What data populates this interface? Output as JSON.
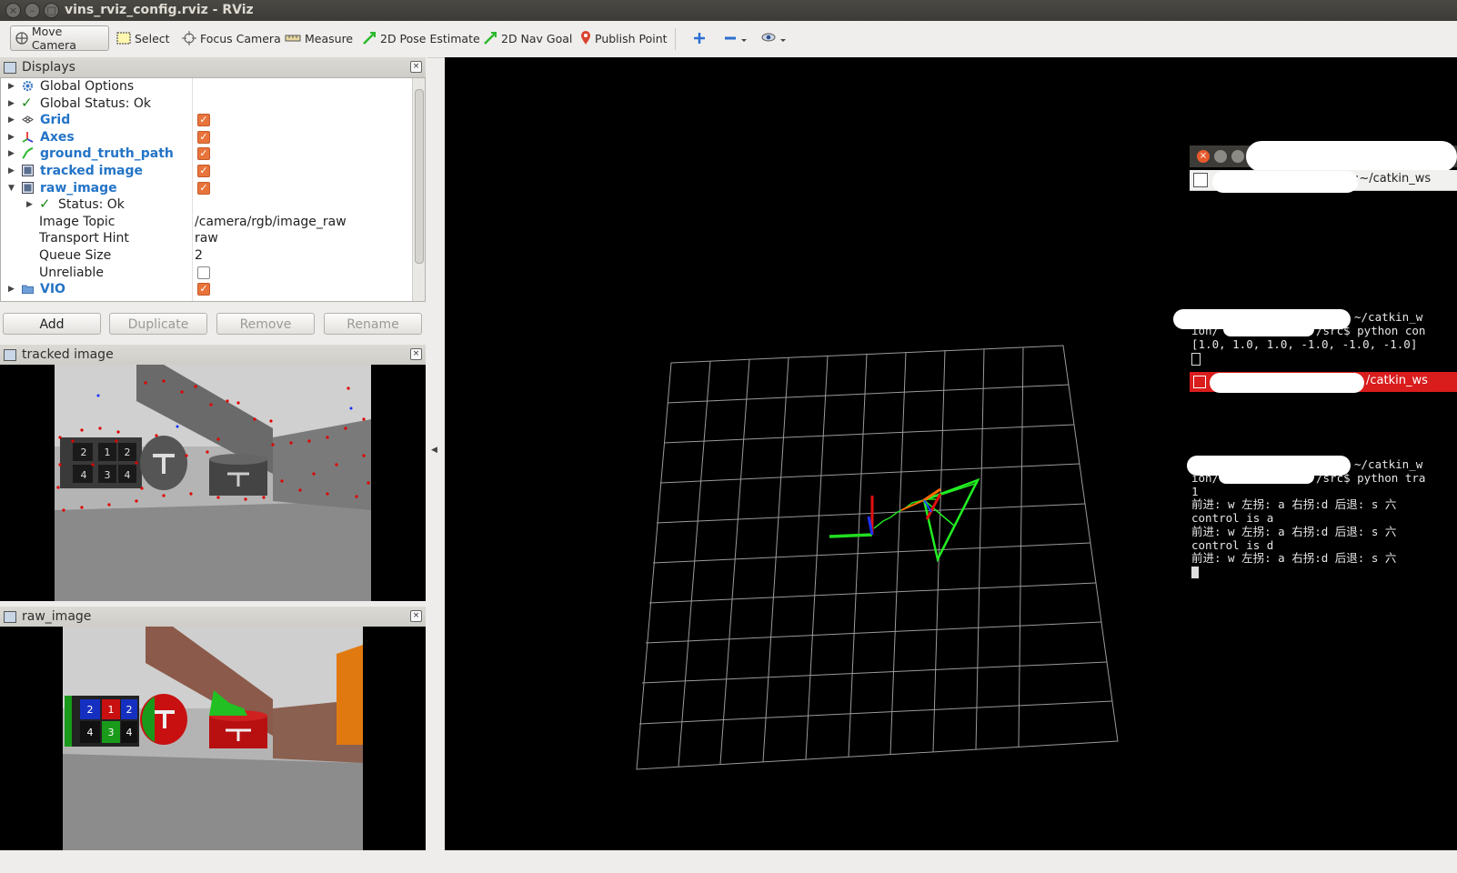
{
  "window": {
    "title": "vins_rviz_config.rviz - RViz"
  },
  "toolbar": {
    "tools": [
      {
        "label": "Move Camera",
        "icon": "move-camera-icon"
      },
      {
        "label": "Select",
        "icon": "select-icon"
      },
      {
        "label": "Focus Camera",
        "icon": "focus-camera-icon"
      },
      {
        "label": "Measure",
        "icon": "measure-icon"
      },
      {
        "label": "2D Pose Estimate",
        "icon": "pose-estimate-icon"
      },
      {
        "label": "2D Nav Goal",
        "icon": "nav-goal-icon"
      },
      {
        "label": "Publish Point",
        "icon": "publish-point-icon"
      }
    ]
  },
  "displays": {
    "title": "Displays",
    "items": [
      {
        "label": "Global Options"
      },
      {
        "label": "Global Status: Ok"
      },
      {
        "label": "Grid",
        "checked": true
      },
      {
        "label": "Axes",
        "checked": true
      },
      {
        "label": "ground_truth_path",
        "checked": true
      },
      {
        "label": "tracked image",
        "checked": true
      },
      {
        "label": "raw_image",
        "checked": true
      },
      {
        "label": "Status: Ok"
      },
      {
        "label": "Image Topic",
        "value": "/camera/rgb/image_raw"
      },
      {
        "label": "Transport Hint",
        "value": "raw"
      },
      {
        "label": "Queue Size",
        "value": "2"
      },
      {
        "label": "Unreliable",
        "checked": false
      },
      {
        "label": "VIO",
        "checked": true
      }
    ],
    "buttons": {
      "add": "Add",
      "duplicate": "Duplicate",
      "remove": "Remove",
      "rename": "Rename"
    }
  },
  "panels": {
    "tracked": "tracked image",
    "raw": "raw_image"
  },
  "image_labels": {
    "tracked": [
      "2",
      "1",
      "2",
      "4",
      "3",
      "4"
    ],
    "raw": [
      "2",
      "1",
      "2",
      "4",
      "3",
      "4"
    ]
  },
  "terminal": {
    "tab1_path": ":~/catkin_ws",
    "block1": [
      "~/catkin_w",
      "ion/",
      "/src$ python con",
      "[1.0, 1.0, 1.0, -1.0, -1.0, -1.0]"
    ],
    "tab2_path": "/catkin_ws",
    "block2": [
      "~/catkin_w",
      "ion/",
      "/src$ python tra",
      "1",
      "前进: w 左拐: a 右拐:d 后退: s 六",
      "control is a",
      "前进: w 左拐: a 右拐:d 后退: s 六",
      "control is d",
      "前进: w 左拐: a 右拐:d 后退: s 六"
    ]
  },
  "colors": {
    "checkbox": "#e8743b",
    "link_blue": "#2474c7",
    "grid_line": "#a0a0a0",
    "path_green": "#22dd22",
    "terminal_red": "#d91c1c"
  }
}
